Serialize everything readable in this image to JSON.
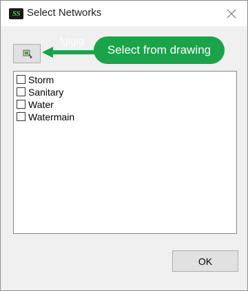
{
  "window": {
    "title": "Select Networks",
    "app_icon_text": "SS",
    "close_icon": "close-icon"
  },
  "toolbar": {
    "select_button_icon": "select-from-drawing-icon"
  },
  "annotation": {
    "ghost_text": "tgtgtg",
    "callout_text": "Select from drawing",
    "callout_color": "#1ba34a",
    "arrow_color": "#1ba34a"
  },
  "networks": {
    "items": [
      {
        "label": "Storm",
        "checked": false
      },
      {
        "label": "Sanitary",
        "checked": false
      },
      {
        "label": "Water",
        "checked": false
      },
      {
        "label": "Watermain",
        "checked": false
      }
    ]
  },
  "buttons": {
    "ok_label": "OK"
  }
}
